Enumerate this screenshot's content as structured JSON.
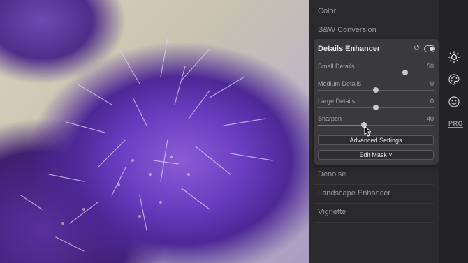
{
  "sections_above": [
    "Color",
    "B&W Conversion"
  ],
  "card": {
    "title": "Details Enhancer",
    "enabled": true,
    "accent": "#5a7fd6",
    "sliders": [
      {
        "label": "Small Details",
        "value": "50",
        "fraction": 0.75,
        "fill_from": 0.5
      },
      {
        "label": "Medium Details",
        "value": "0",
        "fraction": 0.5,
        "fill_from": 0.5
      },
      {
        "label": "Large Details",
        "value": "0",
        "fraction": 0.5,
        "fill_from": 0.5
      },
      {
        "label": "Sharpen",
        "value": "40",
        "fraction": 0.4,
        "fill_from": 0.0
      }
    ],
    "buttons": {
      "advanced": "Advanced Settings",
      "mask": "Edit Mask ˅"
    }
  },
  "sections_below": [
    "Denoise",
    "Landscape Enhancer",
    "Vignette"
  ],
  "rail": {
    "icons": [
      "sun-icon",
      "palette-icon",
      "smiley-icon"
    ],
    "pro_label": "PRO"
  }
}
